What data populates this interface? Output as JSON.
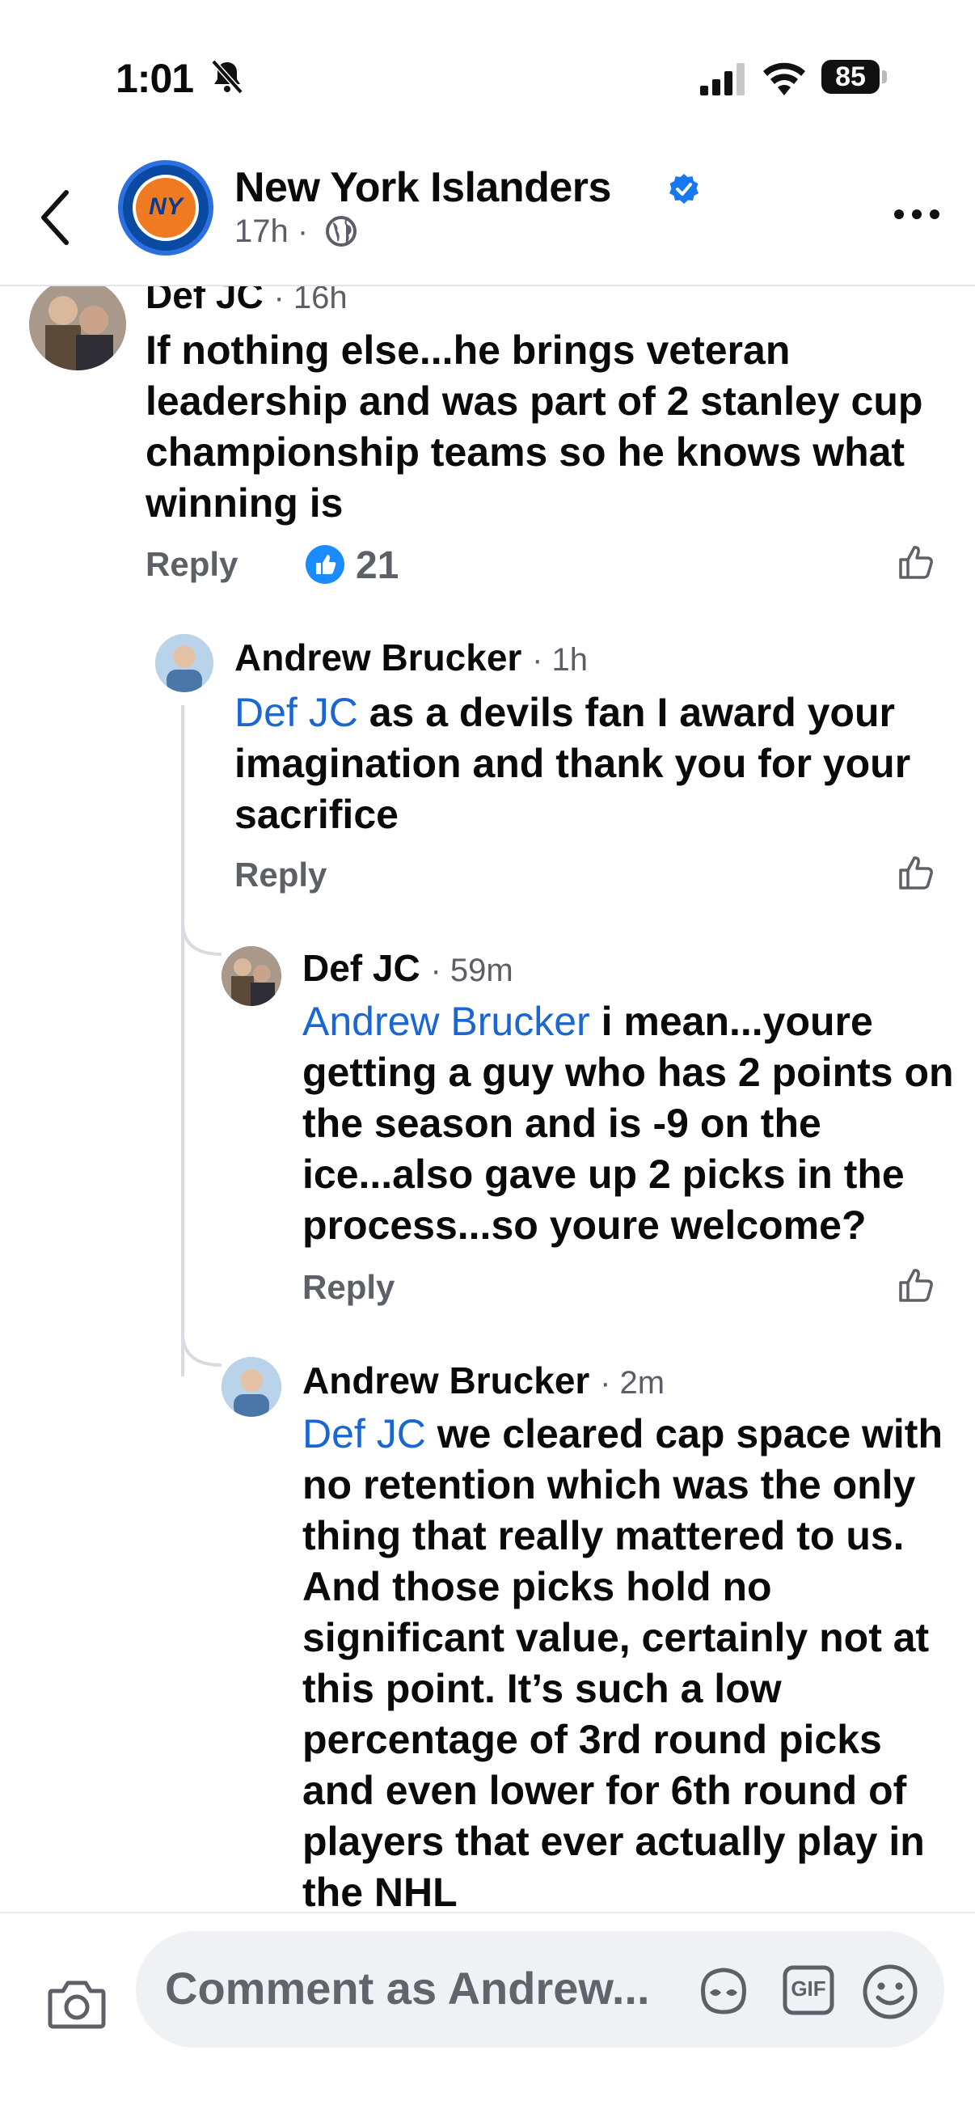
{
  "status_bar": {
    "time": "1:01",
    "battery": "85"
  },
  "header": {
    "page_name": "New York Islanders",
    "time_ago": "17h",
    "separator": "·",
    "avatar_text": "NY"
  },
  "comments": [
    {
      "author": "Def JC",
      "time": "· 16h",
      "text": "If nothing else...he brings veteran leadership and was part of 2 stanley cup championship teams so he knows what winning is",
      "reply": "Reply",
      "reactions": "21"
    },
    {
      "author": "Andrew Brucker",
      "time": "· 1h",
      "mention": "Def JC",
      "text": " as a devils fan I award your imagination and thank you for your sacrifice",
      "reply": "Reply"
    },
    {
      "author": "Def JC",
      "time": "· 59m",
      "mention": "Andrew Brucker",
      "text": " i mean...youre getting a guy who has 2 points on the season and is -9 on the ice...also gave up 2 picks in the process...so youre welcome?",
      "reply": "Reply"
    },
    {
      "author": "Andrew Brucker",
      "time": "· 2m",
      "mention": "Def JC",
      "text": " we cleared cap space with no retention which was the only thing that really mattered to us. And those picks hold no significant value, certainly not at this point. It’s such a low percentage of 3rd round picks and even lower for 6th round of players that ever actually play in the NHL"
    }
  ],
  "composer": {
    "placeholder": "Comment as Andrew...",
    "gif_label": "GIF"
  },
  "colors": {
    "mention": "#1a66d2",
    "like": "#1a8cff",
    "verified": "#1877f2"
  }
}
